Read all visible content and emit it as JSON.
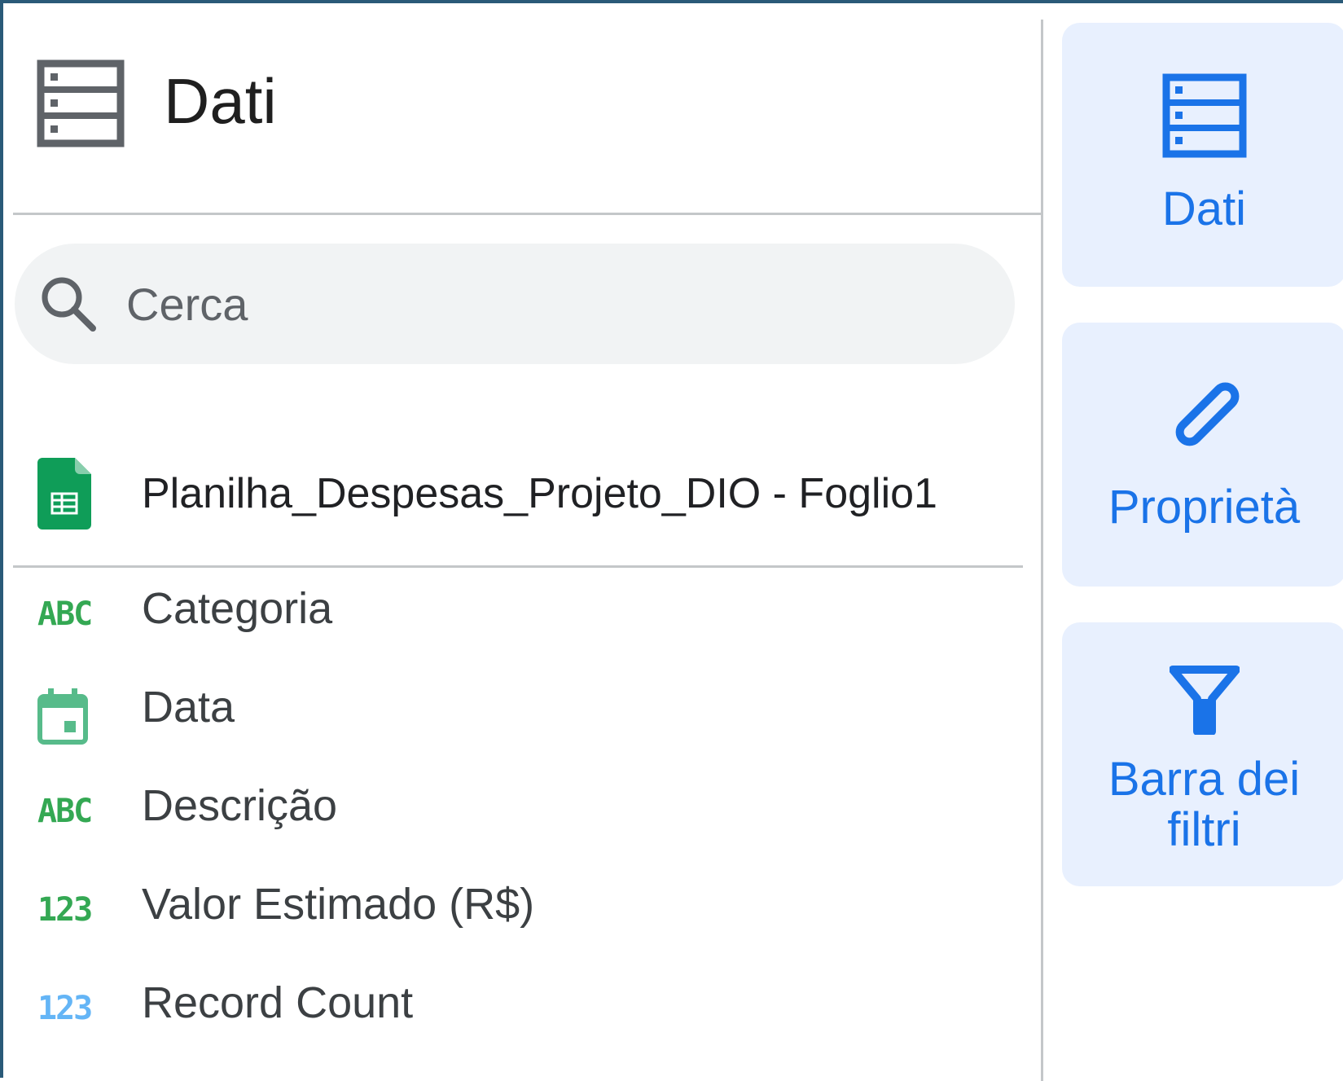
{
  "panel": {
    "title": "Dati",
    "icon": "database-icon"
  },
  "search": {
    "placeholder": "Cerca",
    "value": ""
  },
  "data_source": {
    "name": "Planilha_Despesas_Projeto_DIO - Foglio1",
    "icon": "google-sheets-icon"
  },
  "fields": [
    {
      "type": "text",
      "type_glyph": "ABC",
      "label": "Categoria"
    },
    {
      "type": "date",
      "type_glyph": "calendar-icon",
      "label": "Data"
    },
    {
      "type": "text",
      "type_glyph": "ABC",
      "label": "Descrição"
    },
    {
      "type": "number",
      "type_glyph": "123",
      "label": "Valor Estimado (R$)"
    },
    {
      "type": "metric",
      "type_glyph": "123",
      "label": "Record Count"
    }
  ],
  "rail_tabs": [
    {
      "label": "Dati",
      "icon": "database-icon"
    },
    {
      "label": "Proprietà",
      "icon": "pencil-icon"
    },
    {
      "label": "Barra dei filtri",
      "icon": "filter-icon"
    }
  ],
  "colors": {
    "accent_blue": "#1a73e8",
    "tab_background": "#e8f0fe",
    "field_text_type": "#34a853",
    "field_metric_type": "#64b5f6",
    "sheets_green": "#0f9d58",
    "divider": "#c4c7c9",
    "search_background": "#f1f3f4"
  }
}
